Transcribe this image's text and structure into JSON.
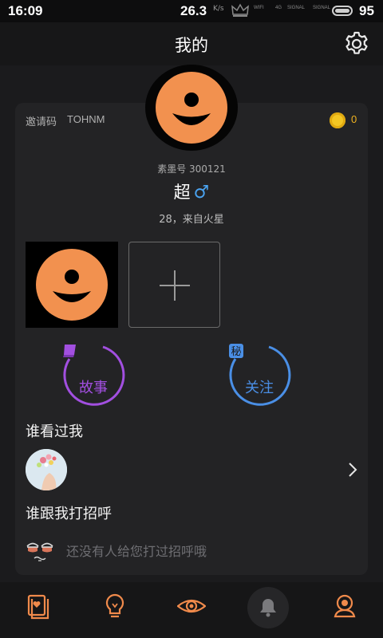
{
  "status_bar": {
    "time": "16:09",
    "net_speed": "26.3",
    "net_unit": "K/s",
    "signal_labels": [
      "WIFI",
      "4G",
      "SIGNAL",
      "SIGNAL"
    ],
    "battery_level": "95"
  },
  "header": {
    "title": "我的",
    "settings_icon": "gear-icon"
  },
  "profile": {
    "invite_label": "邀请码",
    "invite_code": "TOHNM",
    "coin_count": "0",
    "suomo_id": "素墨号 300121",
    "name": "超",
    "gender_symbol": "♂",
    "age_location": "28，来自火星",
    "photos_count": 1
  },
  "actions": {
    "story_label": "故事",
    "follow_label": "关注"
  },
  "sections": {
    "visitors_title": "谁看过我",
    "greet_title": "谁跟我打招呼",
    "greet_empty": "还没有人给您打过招呼哦"
  },
  "tabs": [
    {
      "icon": "cards-icon"
    },
    {
      "icon": "bulb-icon"
    },
    {
      "icon": "eye-icon"
    },
    {
      "icon": "bell-icon",
      "selected": true
    },
    {
      "icon": "person-icon"
    }
  ],
  "colors": {
    "accent_orange": "#f08a4b",
    "story_purple": "#a24fe0",
    "follow_blue": "#4a8fe6",
    "male_blue": "#4aa3f0",
    "coin_gold": "#f3c623",
    "background": "#1b1b1d",
    "card": "#232325"
  }
}
